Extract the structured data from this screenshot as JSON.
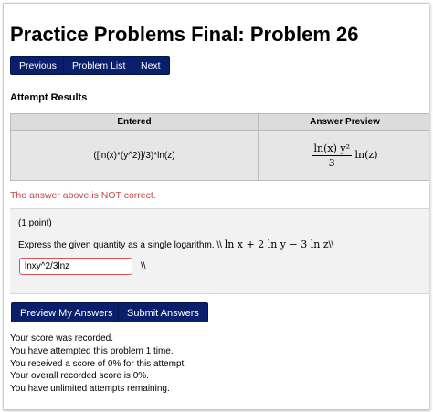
{
  "page": {
    "title": "Practice Problems Final: Problem 26"
  },
  "nav": {
    "previous": "Previous",
    "problem_list": "Problem List",
    "next": "Next"
  },
  "attempt": {
    "heading": "Attempt Results",
    "col_entered": "Entered",
    "col_preview": "Answer Preview",
    "entered": "([ln(x)*(y^2)]/3)*ln(z)",
    "preview": {
      "numerator": "ln(x) y²",
      "denominator": "3",
      "trailing": "ln(z)"
    },
    "feedback": "The answer above is NOT correct."
  },
  "problem": {
    "points": "(1 point)",
    "prompt_text": "Express the given quantity as a single logarithm. \\\\",
    "prompt_math": "ln x + 2 ln y − 3 ln z",
    "prompt_tail": "\\\\",
    "answer_value": "lnxy^2/3lnz",
    "answer_suffix": "\\\\"
  },
  "actions": {
    "preview": "Preview My Answers",
    "submit": "Submit Answers"
  },
  "status": {
    "line1": "Your score was recorded.",
    "line2": "You have attempted this problem 1 time.",
    "line3": "You received a score of 0% for this attempt.",
    "line4": "Your overall recorded score is 0%.",
    "line5": "You have unlimited attempts remaining."
  },
  "colors": {
    "button_bg": "#0a1f6b",
    "error_text": "#c44a4a",
    "input_border_error": "#d9534f"
  }
}
